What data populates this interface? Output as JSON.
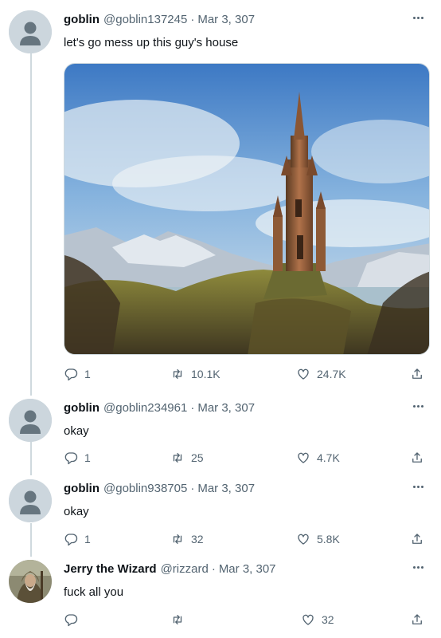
{
  "tweets": [
    {
      "name": "goblin",
      "handle": "@goblin137245",
      "separator": "·",
      "date": "Mar 3, 307",
      "text": "let's go mess up this guy's house",
      "replies": "1",
      "retweets": "10.1K",
      "likes": "24.7K",
      "avatar": "default-avatar",
      "media": "wizard-tower-painting"
    },
    {
      "name": "goblin",
      "handle": "@goblin234961",
      "separator": "·",
      "date": "Mar 3, 307",
      "text": "okay",
      "replies": "1",
      "retweets": "25",
      "likes": "4.7K",
      "avatar": "default-avatar"
    },
    {
      "name": "goblin",
      "handle": "@goblin938705",
      "separator": "·",
      "date": "Mar 3, 307",
      "text": "okay",
      "replies": "1",
      "retweets": "32",
      "likes": "5.8K",
      "avatar": "default-avatar"
    },
    {
      "name": "Jerry the Wizard",
      "handle": "@rizzard",
      "separator": "·",
      "date": "Mar 3, 307",
      "text": "fuck all you",
      "replies": "",
      "retweets": "",
      "likes": "32",
      "avatar": "wizard-photo"
    }
  ],
  "colors": {
    "text_primary": "#0f1419",
    "text_secondary": "#536471",
    "thread_line": "#cfd9de",
    "avatar_placeholder": "#ccd6dd"
  },
  "icons": [
    "reply-icon",
    "retweet-icon",
    "like-icon",
    "share-icon",
    "more-icon"
  ]
}
